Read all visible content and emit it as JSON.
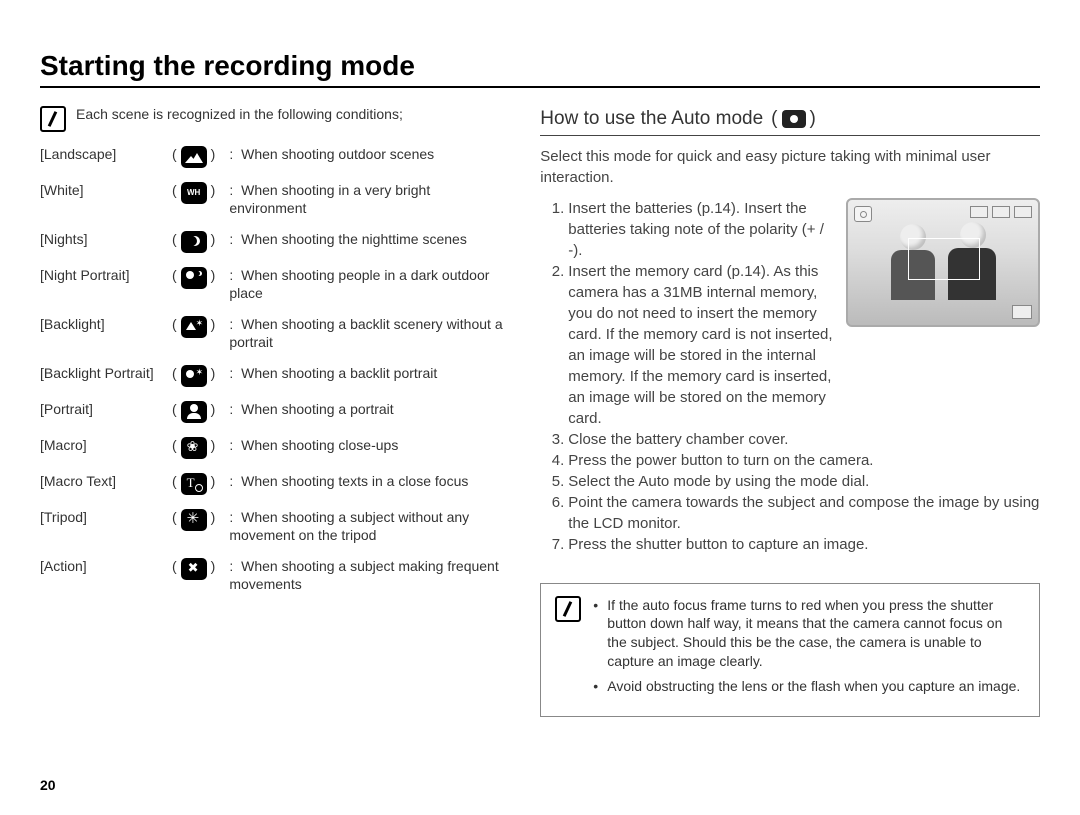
{
  "title": "Starting the recording mode",
  "page_number": "20",
  "scene_intro": "Each scene is recognized in the following conditions;",
  "scenes": [
    {
      "name": "[Landscape]",
      "icon": "landscape-icon",
      "desc": "When shooting outdoor scenes"
    },
    {
      "name": "[White]",
      "icon": "white-icon",
      "desc": "When shooting in a very bright environment"
    },
    {
      "name": "[Nights]",
      "icon": "nights-icon",
      "desc": "When shooting the nighttime scenes"
    },
    {
      "name": "[Night Portrait]",
      "icon": "night-portrait-icon",
      "desc": "When shooting people in a dark outdoor place"
    },
    {
      "name": "[Backlight]",
      "icon": "backlight-icon",
      "desc": "When shooting a backlit scenery without a portrait"
    },
    {
      "name": "[Backlight Portrait]",
      "icon": "backlight-portrait-icon",
      "desc": "When shooting a backlit portrait"
    },
    {
      "name": "[Portrait]",
      "icon": "portrait-icon",
      "desc": "When shooting a portrait"
    },
    {
      "name": "[Macro]",
      "icon": "macro-icon",
      "desc": "When shooting close-ups"
    },
    {
      "name": "[Macro Text]",
      "icon": "macro-text-icon",
      "desc": "When shooting texts in a close focus"
    },
    {
      "name": "[Tripod]",
      "icon": "tripod-icon",
      "desc": "When shooting a subject without any movement on the tripod"
    },
    {
      "name": "[Action]",
      "icon": "action-icon",
      "desc": "When shooting a subject making frequent movements"
    }
  ],
  "subhead": "How to use the Auto mode",
  "subhead_paren_open": "(",
  "subhead_paren_close": ")",
  "intro": "Select this mode for quick and easy picture taking with minimal user interaction.",
  "steps": [
    "Insert the batteries (p.14). Insert the batteries taking note of the polarity (+ / -).",
    "Insert the memory card (p.14). As this camera has a 31MB internal memory, you do not need to insert the memory card. If the memory card is not inserted, an image will be stored in the internal memory. If the memory card is inserted, an image will be stored on the memory card.",
    "Close the battery chamber cover.",
    "Press the power button to turn on the camera.",
    "Select the Auto mode by using the mode dial.",
    "Point the camera towards the subject and compose the image by using the LCD monitor.",
    "Press the shutter button to capture an image."
  ],
  "bottom_notes": [
    "If the auto focus frame turns to red when you press the shutter button down half way, it means that the camera cannot focus on the subject. Should this be the case, the camera is unable to capture an image clearly.",
    "Avoid obstructing the lens or the flash when you capture an image."
  ]
}
